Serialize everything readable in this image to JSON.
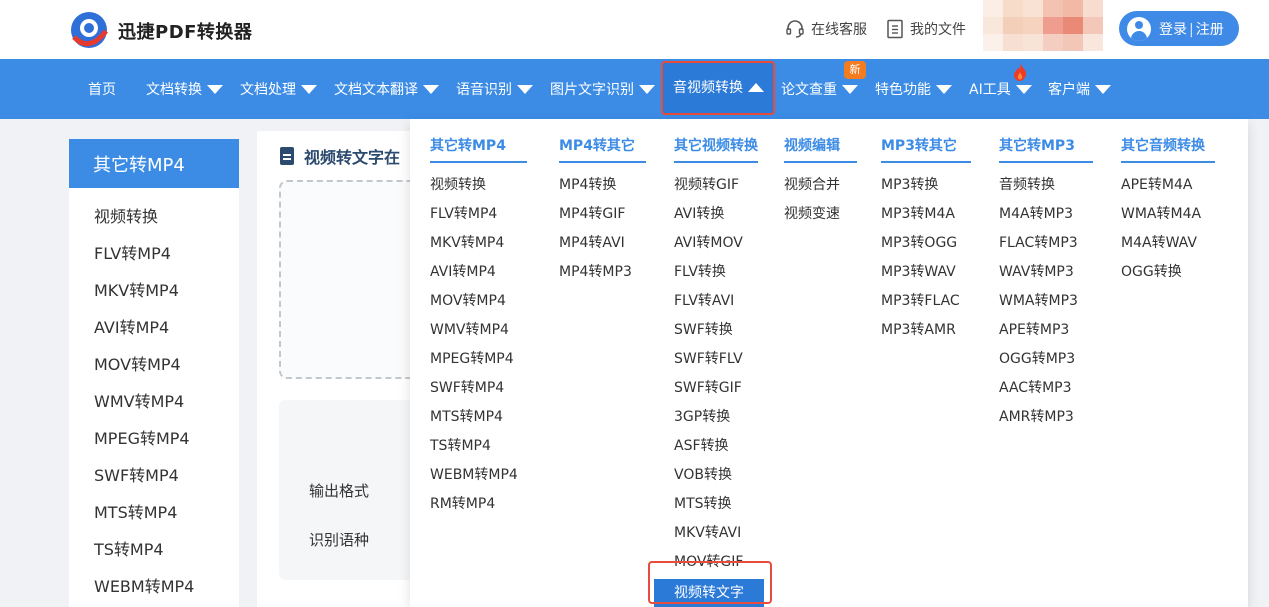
{
  "brand": {
    "name": "迅捷PDF转换器",
    "logo_icon": "xunjie-logo"
  },
  "header": {
    "service_label": "在线客服",
    "service_icon": "headset-icon",
    "files_label": "我的文件",
    "files_icon": "file-list-icon",
    "login_label": "登录",
    "register_label": "注册",
    "login_separator": "|"
  },
  "nav": {
    "items": [
      {
        "label": "首页"
      },
      {
        "label": "文档转换"
      },
      {
        "label": "文档处理"
      },
      {
        "label": "文档文本翻译"
      },
      {
        "label": "语音识别"
      },
      {
        "label": "图片文字识别"
      },
      {
        "label": "音视频转换"
      },
      {
        "label": "论文查重"
      },
      {
        "label": "特色功能"
      },
      {
        "label": "AI工具"
      },
      {
        "label": "客户端"
      }
    ],
    "new_badge": "新",
    "active_index": 6,
    "accent": "#3c8ce6",
    "highlight_outline": "#e74c3c"
  },
  "sidebar": {
    "title": "其它转MP4",
    "items": [
      "视频转换",
      "FLV转MP4",
      "MKV转MP4",
      "AVI转MP4",
      "MOV转MP4",
      "WMV转MP4",
      "MPEG转MP4",
      "SWF转MP4",
      "MTS转MP4",
      "TS转MP4",
      "WEBM转MP4"
    ]
  },
  "main": {
    "title": "视频转文字在",
    "output_format_label": "输出格式",
    "language_label": "识别语种"
  },
  "menu": {
    "columns": [
      {
        "title": "其它转MP4",
        "items": [
          "视频转换",
          "FLV转MP4",
          "MKV转MP4",
          "AVI转MP4",
          "MOV转MP4",
          "WMV转MP4",
          "MPEG转MP4",
          "SWF转MP4",
          "MTS转MP4",
          "TS转MP4",
          "WEBM转MP4",
          "RM转MP4"
        ]
      },
      {
        "title": "MP4转其它",
        "items": [
          "MP4转换",
          "MP4转GIF",
          "MP4转AVI",
          "MP4转MP3"
        ]
      },
      {
        "title": "其它视频转换",
        "items": [
          "视频转GIF",
          "AVI转换",
          "AVI转MOV",
          "FLV转换",
          "FLV转AVI",
          "SWF转换",
          "SWF转FLV",
          "SWF转GIF",
          "3GP转换",
          "ASF转换",
          "VOB转换",
          "MTS转换",
          "MKV转AVI",
          "MOV转GIF",
          "视频转文字"
        ]
      },
      {
        "title": "视频编辑",
        "items": [
          "视频合并",
          "视频变速"
        ]
      },
      {
        "title": "MP3转其它",
        "items": [
          "MP3转换",
          "MP3转M4A",
          "MP3转OGG",
          "MP3转WAV",
          "MP3转FLAC",
          "MP3转AMR"
        ]
      },
      {
        "title": "其它转MP3",
        "items": [
          "音频转换",
          "M4A转MP3",
          "FLAC转MP3",
          "WAV转MP3",
          "WMA转MP3",
          "APE转MP3",
          "OGG转MP3",
          "AAC转MP3",
          "AMR转MP3"
        ]
      },
      {
        "title": "其它音频转换",
        "items": [
          "APE转M4A",
          "WMA转M4A",
          "M4A转WAV",
          "OGG转换"
        ]
      }
    ],
    "highlighted_item": "视频转文字"
  }
}
